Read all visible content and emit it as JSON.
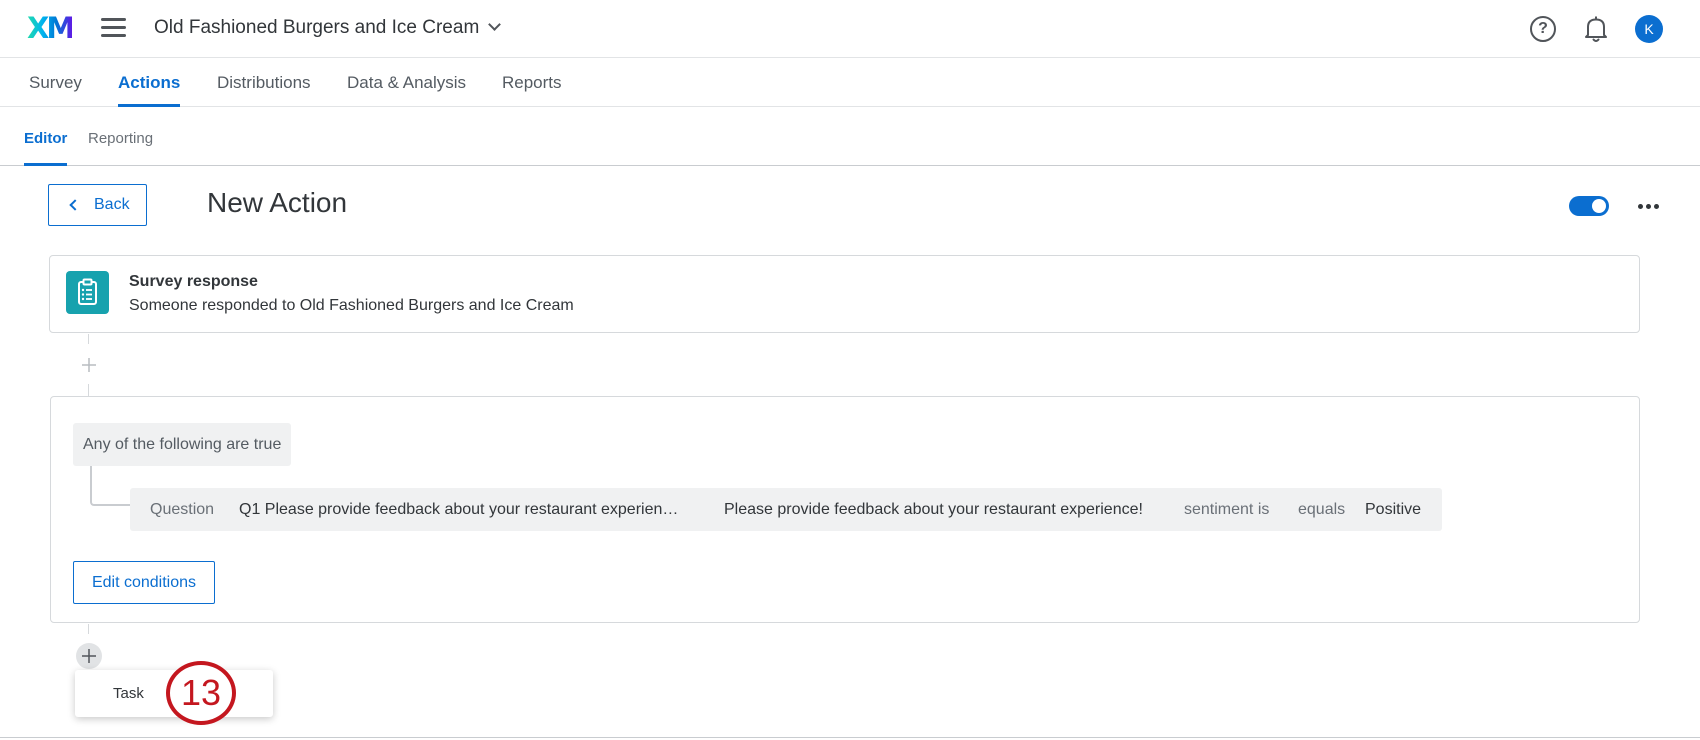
{
  "topbar": {
    "logo_text": "XM",
    "project_title": "Old Fashioned Burgers and Ice Cream",
    "help_glyph": "?",
    "avatar_initial": "K",
    "icons": [
      "hamburger-menu-icon",
      "chevron-down-icon",
      "help-icon",
      "bell-icon"
    ]
  },
  "main_nav": {
    "tabs": [
      {
        "label": "Survey"
      },
      {
        "label": "Actions",
        "active": true
      },
      {
        "label": "Distributions"
      },
      {
        "label": "Data & Analysis"
      },
      {
        "label": "Reports"
      }
    ]
  },
  "sub_nav": {
    "tabs": [
      {
        "label": "Editor",
        "active": true
      },
      {
        "label": "Reporting"
      }
    ]
  },
  "header": {
    "back_label": "Back",
    "title": "New Action",
    "toggle_on": true
  },
  "trigger": {
    "title": "Survey response",
    "description": "Someone responded to Old Fashioned Burgers and Ice Cream",
    "icon": "clipboard-icon"
  },
  "conditions": {
    "group_label": "Any of the following are true",
    "row": {
      "type": "Question",
      "question": "Q1 Please provide feedback about your restaurant experien…",
      "field": "Please provide feedback about your restaurant experience!",
      "metric": "sentiment is",
      "operator": "equals",
      "value": "Positive"
    },
    "edit_label": "Edit conditions"
  },
  "add_menu": {
    "items": [
      {
        "label": "Task"
      }
    ]
  },
  "annotation": {
    "step_number": "13"
  },
  "colors": {
    "accent": "#0b6ed0",
    "trigger_icon_bg": "#17a2ae",
    "step_badge": "#c4171f"
  }
}
